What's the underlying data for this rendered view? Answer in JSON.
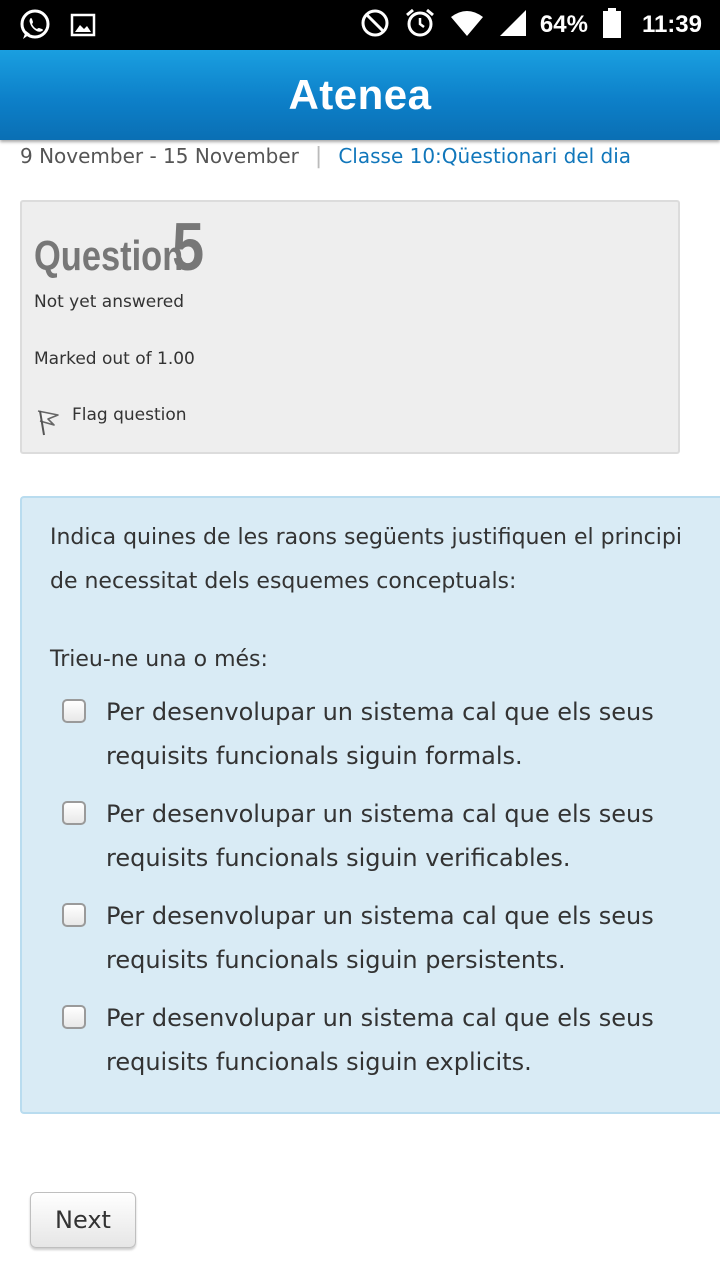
{
  "status_bar": {
    "battery_percent": "64%",
    "time": "11:39",
    "left_icons": [
      "whatsapp-icon",
      "image-icon"
    ],
    "right_icons": [
      "do-not-disturb-icon",
      "alarm-icon",
      "wifi-icon",
      "signal-icon",
      "battery-icon"
    ]
  },
  "app_bar": {
    "title": "Atenea",
    "color": "#0d80c9"
  },
  "breadcrumb": {
    "week": "9 November - 15 November",
    "separator": "|",
    "activity": "Classe 10:Qüestionari del dia"
  },
  "question_info": {
    "title_word": "Question",
    "number": "5",
    "state": "Not yet answered",
    "marks": "Marked out of 1.00",
    "flag_label": "Flag question"
  },
  "question": {
    "text": "Indica quines de les raons següents justifiquen el principi de necessitat dels esquemes conceptuals:",
    "prompt": "Trieu-ne una o més:",
    "options": [
      {
        "label": "Per desenvolupar un sistema cal que els seus requisits funcionals siguin formals.",
        "checked": false
      },
      {
        "label": "Per desenvolupar un sistema cal que els seus requisits funcionals siguin verificables.",
        "checked": false
      },
      {
        "label": "Per desenvolupar un sistema cal que els seus requisits funcionals siguin persistents.",
        "checked": false
      },
      {
        "label": "Per desenvolupar un sistema cal que els seus requisits funcionals siguin explicits.",
        "checked": false
      }
    ]
  },
  "navigation": {
    "next_label": "Next"
  }
}
